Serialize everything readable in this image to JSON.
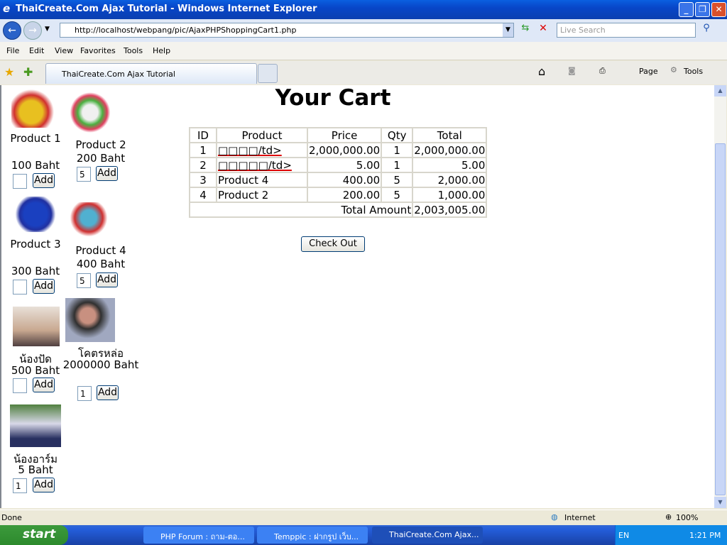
{
  "window": {
    "title": "ThaiCreate.Com Ajax Tutorial - Windows Internet Explorer"
  },
  "address": {
    "url": "http://localhost/webpang/pic/AjaxPHPShoppingCart1.php",
    "search_placeholder": "Live Search"
  },
  "menu": [
    "File",
    "Edit",
    "View",
    "Favorites",
    "Tools",
    "Help"
  ],
  "tab": {
    "label": "ThaiCreate.Com Ajax Tutorial"
  },
  "toolbar": {
    "page": "Page",
    "tools": "Tools"
  },
  "products": [
    {
      "name": "Product 1",
      "price": "100 Baht",
      "qty": ""
    },
    {
      "name": "Product 2",
      "price": "200 Baht",
      "qty": "5"
    },
    {
      "name": "Product 3",
      "price": "300 Baht",
      "qty": ""
    },
    {
      "name": "Product 4",
      "price": "400 Baht",
      "qty": "5"
    },
    {
      "name": "น้องปัด",
      "price": "500 Baht",
      "qty": ""
    },
    {
      "name": "โคตรหล่อ",
      "price": "2000000 Baht",
      "qty": "1"
    },
    {
      "name": "น้องอาร์ม",
      "price": "5 Baht",
      "qty": "1"
    }
  ],
  "add_label": "Add",
  "cart": {
    "title": "Your Cart",
    "headers": [
      "ID",
      "Product",
      "Price",
      "Qty",
      "Total"
    ],
    "rows": [
      [
        "1",
        "□□□□/td>",
        "2,000,000.00",
        "1",
        "2,000,000.00"
      ],
      [
        "2",
        "□□□□□/td>",
        "5.00",
        "1",
        "5.00"
      ],
      [
        "3",
        "Product 4",
        "400.00",
        "5",
        "2,000.00"
      ],
      [
        "4",
        "Product 2",
        "200.00",
        "5",
        "1,000.00"
      ]
    ],
    "total_label": "Total Amount",
    "total_value": "2,003,005.00",
    "checkout_label": "Check Out"
  },
  "status": {
    "text": "Done",
    "zone": "Internet",
    "zoom": "100%"
  },
  "taskbar": {
    "start": "start",
    "tasks": [
      "PHP Forum : ถาม-ตอ...",
      "Temppic : ฝากรูป เว็บ...",
      "ThaiCreate.Com Ajax..."
    ],
    "lang": "EN",
    "time": "1:21 PM"
  }
}
